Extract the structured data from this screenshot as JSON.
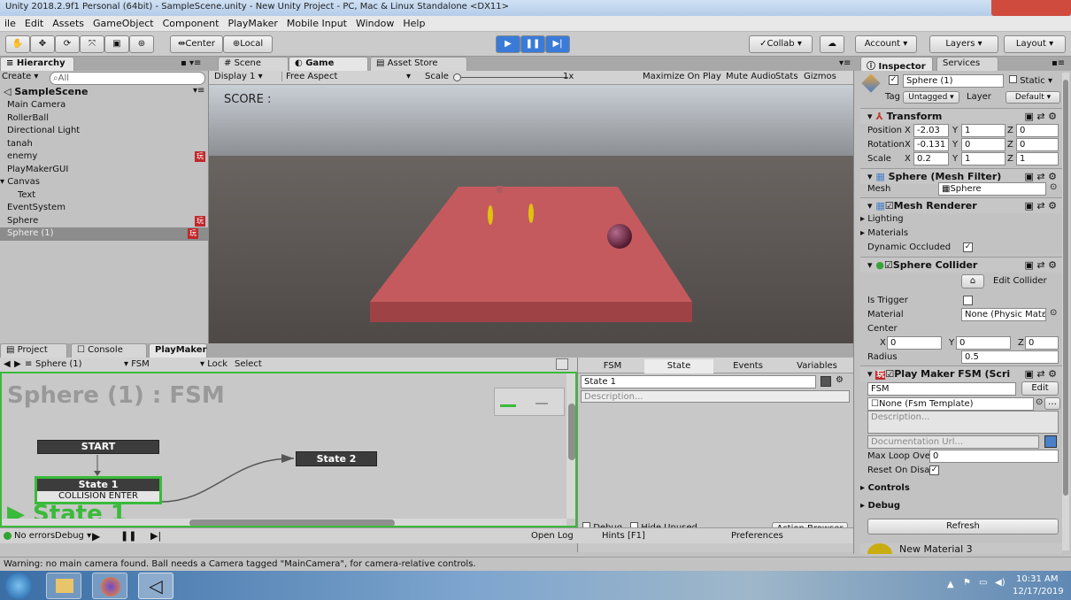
{
  "window": {
    "title": "Unity 2018.2.9f1 Personal (64bit) - SampleScene.unity - New Unity Project - PC, Mac & Linux Standalone <DX11>"
  },
  "menu": [
    "ile",
    "Edit",
    "Assets",
    "GameObject",
    "Component",
    "PlayMaker",
    "Mobile Input",
    "Window",
    "Help"
  ],
  "toolbar": {
    "pivot": "Center",
    "space": "Local",
    "collab": "Collab",
    "account": "Account",
    "layers": "Layers",
    "layout": "Layout"
  },
  "hierarchy": {
    "tab": "Hierarchy",
    "create": "Create",
    "search_placeholder": "All",
    "scene": "SampleScene",
    "items": [
      {
        "name": "Main Camera",
        "indent": 0
      },
      {
        "name": "RollerBall",
        "indent": 0
      },
      {
        "name": "Directional Light",
        "indent": 0
      },
      {
        "name": "tanah",
        "indent": 0
      },
      {
        "name": "enemy",
        "indent": 0,
        "badge": "玩"
      },
      {
        "name": "PlayMakerGUI",
        "indent": 0
      },
      {
        "name": "Canvas",
        "indent": 0,
        "expanded": true
      },
      {
        "name": "Text",
        "indent": 1
      },
      {
        "name": "EventSystem",
        "indent": 0
      },
      {
        "name": "Sphere",
        "indent": 0,
        "badge": "玩"
      },
      {
        "name": "Sphere (1)",
        "indent": 0,
        "badge": "玩",
        "selected": true
      }
    ]
  },
  "center_tabs": {
    "scene": "Scene",
    "game": "Game",
    "asset_store": "Asset Store"
  },
  "game_bar": {
    "display": "Display 1",
    "aspect": "Free Aspect",
    "scale_label": "Scale",
    "scale_value": "1x",
    "maximize": "Maximize On Play",
    "mute": "Mute Audio",
    "stats": "Stats",
    "gizmos": "Gizmos"
  },
  "game_view": {
    "score_text": "SCORE :"
  },
  "inspector": {
    "tab": "Inspector",
    "services_tab": "Services",
    "object_name": "Sphere (1)",
    "static_label": "Static",
    "tag_label": "Tag",
    "tag_value": "Untagged",
    "layer_label": "Layer",
    "layer_value": "Default",
    "transform": {
      "title": "Transform",
      "position_label": "Position",
      "rotation_label": "Rotation",
      "scale_label": "Scale",
      "position": {
        "x": "-2.03",
        "y": "1",
        "z": "0"
      },
      "rotation": {
        "x": "-0.131",
        "y": "0",
        "z": "0"
      },
      "scale": {
        "x": "0.2",
        "y": "1",
        "z": "1"
      }
    },
    "mesh_filter": {
      "title": "Sphere (Mesh Filter)",
      "mesh_label": "Mesh",
      "mesh_value": "Sphere"
    },
    "mesh_renderer": {
      "title": "Mesh Renderer",
      "lighting": "Lighting",
      "materials": "Materials",
      "dynamic_occluded": "Dynamic Occluded"
    },
    "sphere_collider": {
      "title": "Sphere Collider",
      "edit_collider": "Edit Collider",
      "is_trigger": "Is Trigger",
      "material_label": "Material",
      "material_value": "None (Physic Matε",
      "center_label": "Center",
      "center": {
        "x": "0",
        "y": "0",
        "z": "0"
      },
      "radius_label": "Radius",
      "radius_value": "0.5"
    },
    "playmaker_fsm": {
      "title": "Play Maker FSM (Scri",
      "fsm_name": "FSM",
      "edit": "Edit",
      "template": "None (Fsm Template)",
      "description_placeholder": "Description...",
      "doc_url_placeholder": "Documentation Url...",
      "max_loop_label": "Max Loop Overri",
      "max_loop_value": "0",
      "reset_label": "Reset On Disabl",
      "controls": "Controls",
      "debug": "Debug",
      "refresh": "Refresh"
    },
    "material_footer": "New Material 3"
  },
  "bottom_tabs": {
    "project": "Project",
    "console": "Console",
    "playmaker": "PlayMaker"
  },
  "playmaker": {
    "selected_object": "Sphere (1)",
    "fsm_dropdown": "FSM",
    "lock": "Lock",
    "select": "Select",
    "graph_title": "Sphere (1) : FSM",
    "start_node": "START",
    "state1": "State 1",
    "transition": "COLLISION ENTER",
    "state2": "State 2",
    "big_state_label": "State 1",
    "side_tabs": [
      "FSM",
      "State",
      "Events",
      "Variables"
    ],
    "state_name_value": "State 1",
    "description_placeholder": "Description...",
    "debug_label": "Debug",
    "hide_unused_label": "Hide Unused",
    "action_browser": "Action Browser",
    "no_errors": "No errors",
    "debug_dropdown": "Debug",
    "open_log": "Open Log",
    "hints": "Hints [F1]",
    "preferences": "Preferences"
  },
  "status_bar": {
    "warning": "Warning: no main camera found. Ball needs a Camera tagged \"MainCamera\", for camera-relative controls."
  },
  "taskbar": {
    "time": "10:31 AM",
    "date": "12/17/2019"
  },
  "colors": {
    "selection": "#3d6fb5",
    "play_active": "#3b7bd8",
    "fsm_green": "#3aba3a",
    "platform": "#c55a5e",
    "sky": "#c9cfd6",
    "ground": "#5a5552"
  }
}
